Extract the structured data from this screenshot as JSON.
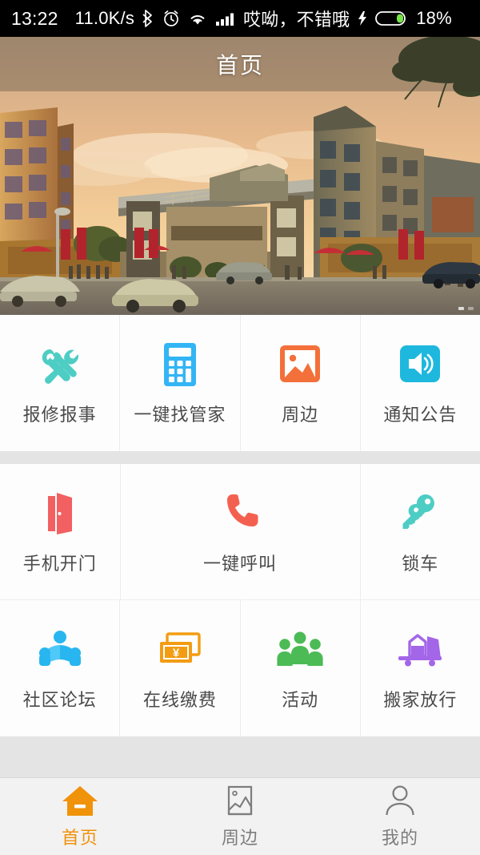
{
  "status_bar": {
    "time": "13:22",
    "network_speed": "11.0K/s",
    "carrier_text": "哎呦，不错哦",
    "battery_percent": "18%",
    "icons": [
      "bluetooth-icon",
      "alarm-icon",
      "wifi-icon",
      "signal-icon",
      "charging-bolt-icon",
      "battery-icon"
    ]
  },
  "header": {
    "title": "首页"
  },
  "banner": {
    "description": "residential-community-rendering",
    "pager_total": 3,
    "pager_active": 1
  },
  "grid": {
    "groups": [
      {
        "rows": [
          {
            "cells": [
              {
                "label": "报修报事",
                "icon": "tools-icon",
                "color": "#4ECDC4",
                "span": 1
              },
              {
                "label": "一键找管家",
                "icon": "calculator-icon",
                "color": "#33B5F5",
                "span": 1
              },
              {
                "label": "周边",
                "icon": "photo-icon",
                "color": "#F3703A",
                "span": 1
              },
              {
                "label": "通知公告",
                "icon": "speaker-icon",
                "color": "#1EB8DE",
                "span": 1
              }
            ]
          }
        ]
      },
      {
        "rows": [
          {
            "cells": [
              {
                "label": "手机开门",
                "icon": "door-icon",
                "color": "#F26061",
                "span": 1
              },
              {
                "label": "一键呼叫",
                "icon": "phone-icon",
                "color": "#F4604F",
                "span": 2
              },
              {
                "label": "锁车",
                "icon": "keys-icon",
                "color": "#4ECDC4",
                "span": 1
              }
            ]
          },
          {
            "cells": [
              {
                "label": "社区论坛",
                "icon": "open-book-reader-icon",
                "color": "#29B6F0",
                "span": 1
              },
              {
                "label": "在线缴费",
                "icon": "payment-cards-yuan-icon",
                "color": "#F39C12",
                "span": 1
              },
              {
                "label": "活动",
                "icon": "people-group-icon",
                "color": "#4CBB56",
                "span": 1
              },
              {
                "label": "搬家放行",
                "icon": "moving-truck-icon",
                "color": "#A366E8",
                "span": 1
              }
            ]
          }
        ]
      }
    ]
  },
  "tabbar": {
    "items": [
      {
        "label": "首页",
        "icon": "home-icon",
        "active": true
      },
      {
        "label": "周边",
        "icon": "photo-outline-icon",
        "active": false
      },
      {
        "label": "我的",
        "icon": "person-outline-icon",
        "active": false
      }
    ],
    "active_color": "#F0920A",
    "inactive_color": "#7D7D7D"
  }
}
